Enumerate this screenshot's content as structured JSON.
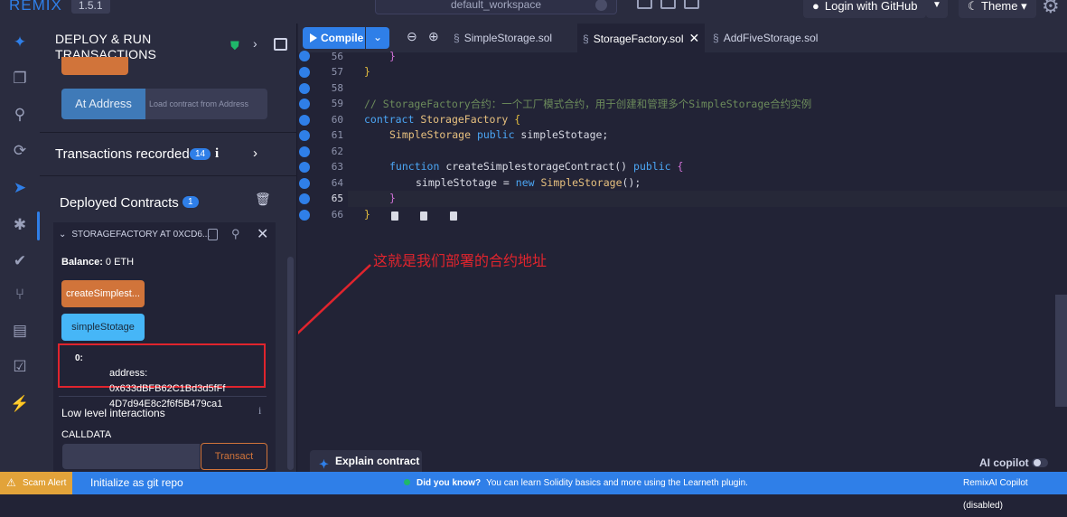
{
  "topbar": {
    "app_name": "REMIX",
    "version": "1.5.1",
    "workspace": "default_workspace",
    "login_label": "Login with GitHub",
    "theme_label": "Theme"
  },
  "side_panel": {
    "title": "DEPLOY & RUN TRANSACTIONS",
    "at_address_label": "At Address",
    "at_address_placeholder": "Load contract from Address",
    "transactions_label": "Transactions recorded",
    "transactions_count": "14",
    "deployed_label": "Deployed Contracts",
    "deployed_count": "1",
    "instance": {
      "name": "STORAGEFACTORY AT 0XCD6...",
      "balance_label": "Balance:",
      "balance_value": "0 ETH",
      "function_buttons": [
        "createSimplest...",
        "simpleStotage"
      ],
      "result_index": "0:",
      "result_line1": "address: 0x633dBFB62C1Bd3d5fFf",
      "result_line2": "4D7d94E8c2f6f5B479ca1"
    },
    "low_level_label": "Low level interactions",
    "calldata_label": "CALLDATA",
    "transact_label": "Transact"
  },
  "editor": {
    "compile_label": "Compile",
    "tabs": [
      "SimpleStorage.sol",
      "StorageFactory.sol",
      "AddFiveStorage.sol"
    ],
    "active_tab": "StorageFactory.sol",
    "line_numbers": [
      "56",
      "57",
      "58",
      "59",
      "60",
      "61",
      "62",
      "63",
      "64",
      "65",
      "66"
    ],
    "code_lines": [
      "}",
      "}",
      "",
      "// StorageFactory合约：一个工厂模式合约，用于创建和管理多个SimpleStorage合约实例",
      "contract StorageFactory {",
      "SimpleStorage public simpleStotage;",
      "",
      "function createSimplestorageContract() public {",
      "simpleStotage = new SimpleStorage();",
      "}",
      "}"
    ],
    "annotation": "这就是我们部署的合约地址",
    "explain_label": "Explain contract",
    "copilot_label": "AI copilot"
  },
  "statusbar": {
    "scam_label": "Scam Alert",
    "git_label": "Initialize as git repo",
    "tip_title": "Did you know?",
    "tip_text": "You can learn Solidity basics and more using the Learneth plugin.",
    "copilot_status": "RemixAI Copilot (disabled)"
  },
  "colors": {
    "accent": "#2f7fe8",
    "orange": "#d1743a",
    "highlight": "#e0242d"
  }
}
